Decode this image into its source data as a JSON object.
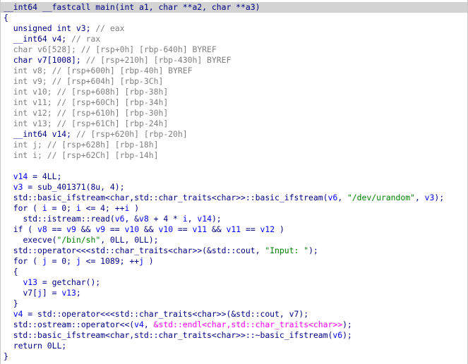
{
  "code": {
    "line01": "__int64 __fastcall main(int a1, char **a2, char **a3)",
    "line02": "{",
    "line03_a": "unsigned int v3; ",
    "line03_b": "// eax",
    "line04_a": "__int64 v4; ",
    "line04_b": "// rax",
    "line05_a": "char v6[528]; ",
    "line05_b": "// [rsp+0h] [rbp-640h] BYREF",
    "line06_a": "char v7[1008]; ",
    "line06_b": "// [rsp+210h] [rbp-430h] BYREF",
    "line07_a": "int v8; ",
    "line07_b": "// [rsp+600h] [rbp-40h] BYREF",
    "line08_a": "int v9; ",
    "line08_b": "// [rsp+604h] [rbp-3Ch]",
    "line09_a": "int v10; ",
    "line09_b": "// [rsp+608h] [rbp-38h]",
    "line10_a": "int v11; ",
    "line10_b": "// [rsp+60Ch] [rbp-34h]",
    "line11_a": "int v12; ",
    "line11_b": "// [rsp+610h] [rbp-30h]",
    "line12_a": "int v13; ",
    "line12_b": "// [rsp+61Ch] [rbp-24h]",
    "line13_a": "__int64 v14; ",
    "line13_b": "// [rsp+620h] [rbp-20h]",
    "line14_a": "int j; ",
    "line14_b": "// [rsp+628h] [rbp-18h]",
    "line15_a": "int i; ",
    "line15_b": "// [rsp+62Ch] [rbp-14h]",
    "line17_v": "v14",
    "line17_r": " = 4LL;",
    "line18_v": "v3",
    "line18_r": " = sub_401371(8u, 4);",
    "line19_a": "std::basic_ifstream<char,std::char_traits<char>>::basic_ifstream(",
    "line19_v6": "v6",
    "line19_b": ", ",
    "line19_s": "\"/dev/urandom\"",
    "line19_c": ", ",
    "line19_v3": "v3",
    "line19_d": ");",
    "line20_a": "for ( ",
    "line20_i1": "i",
    "line20_b": " = 0; ",
    "line20_i2": "i",
    "line20_c": " <= 4; ++",
    "line20_i3": "i",
    "line20_d": " )",
    "line21_a": "std::istream::read(",
    "line21_v6": "v6",
    "line21_b": ", &",
    "line21_v8": "v8",
    "line21_c": " + 4 * ",
    "line21_i": "i",
    "line21_d": ", ",
    "line21_v14": "v14",
    "line21_e": ");",
    "line22_a": "if ( ",
    "line22_v8": "v8",
    "line22_b": " == ",
    "line22_v9a": "v9",
    "line22_c": " && ",
    "line22_v9b": "v9",
    "line22_d": " == ",
    "line22_v10a": "v10",
    "line22_e": " && ",
    "line22_v10b": "v10",
    "line22_f": " == ",
    "line22_v11a": "v11",
    "line22_g": " && ",
    "line22_v11b": "v11",
    "line22_h": " == ",
    "line22_v12": "v12",
    "line22_i": " )",
    "line23_a": "execve(",
    "line23_s": "\"/bin/sh\"",
    "line23_b": ", 0LL, 0LL);",
    "line24_a": "std::operator<<<std::char_traits<char>>(&std::cout, ",
    "line24_s": "\"Input: \"",
    "line24_b": ");",
    "line25_a": "for ( ",
    "line25_j1": "j",
    "line25_b": " = 0; ",
    "line25_j2": "j",
    "line25_c": " <= 1089; ++",
    "line25_j3": "j",
    "line25_d": " )",
    "line26": "{",
    "line27_v": "v13",
    "line27_r": " = getchar();",
    "line28_a": "v7[",
    "line28_j": "j",
    "line28_b": "] = ",
    "line28_v": "v13",
    "line28_c": ";",
    "line29": "}",
    "line30_v": "v4",
    "line30_a": " = std::operator<<<std::char_traits<char>>(&std::cout, ",
    "line30_v7": "v7",
    "line30_b": ");",
    "line31_a": "std::ostream::operator<<(",
    "line31_v4": "v4",
    "line31_b": ", ",
    "line31_p": "&std::endl<char,std::char_traits<char>>",
    "line31_c": ");",
    "line32_a": "std::basic_ifstream<char,std::char_traits<char>>::~basic_ifstream(",
    "line32_v6": "v6",
    "line32_b": ");",
    "line33": "return 0LL;",
    "line34": "}"
  }
}
